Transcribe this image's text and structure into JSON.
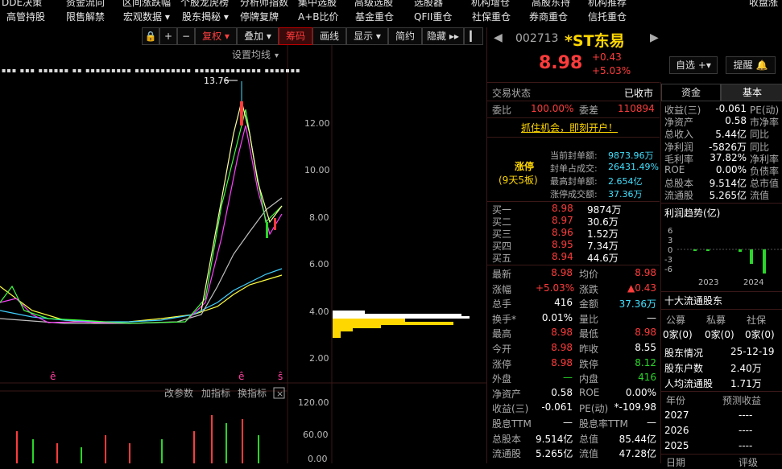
{
  "menu": {
    "row1": [
      "DDE决策",
      "资金流向",
      "区间涨跌幅",
      "个股龙虎榜",
      "分析师指数",
      "集中选股",
      "高级选股",
      "选股器",
      "机构增仓",
      "高股东持",
      "机构推荐",
      "收盘涨"
    ],
    "row2": [
      "高管持股",
      "限售解禁",
      "宏观数据 ▾",
      "股东揭秘 ▾",
      "停牌复牌",
      "A+B比价",
      "基金重仓",
      "QFII重仓",
      "社保重仓",
      "券商重仓",
      "信托重仓"
    ]
  },
  "toolbar": {
    "fuquan": "复权",
    "overlay": "叠加",
    "chip": "筹码",
    "draw": "画线",
    "display": "显示",
    "simple": "简约",
    "hide": "隐藏"
  },
  "chart": {
    "ma_settings": "设置均线",
    "price_axis": [
      "12.00",
      "10.00",
      "8.00",
      "6.00",
      "4.00",
      "2.00"
    ],
    "peak_label": "13.76",
    "indicator_btns": [
      "改参数",
      "加指标",
      "换指标"
    ],
    "vol_axis": [
      "120.00",
      "60.00",
      "0.00"
    ]
  },
  "quote": {
    "code": "002713",
    "name": "*ST东易",
    "price": "8.98",
    "change": "+0.43",
    "pct": "+5.03%",
    "btn_watch": "自选",
    "btn_alert": "提醒",
    "trade_state_label": "交易状态",
    "trade_state": "已收市",
    "weibi_label": "委比",
    "weibi": "100.00%",
    "weicha_label": "委差",
    "weicha": "110894",
    "promo": "抓住机会，即刻开户！",
    "limit_tag": "涨停",
    "limit_days": "(9天5板)",
    "limit_rows": [
      [
        "当前封单额:",
        "9873.96万"
      ],
      [
        "封单占成交:",
        "26431.49%"
      ],
      [
        "最高封单额:",
        "2.654亿"
      ],
      [
        "涨停成交额:",
        "37.36万"
      ]
    ],
    "bids": [
      [
        "买一",
        "8.98",
        "9874万"
      ],
      [
        "买二",
        "8.97",
        "30.6万"
      ],
      [
        "买三",
        "8.96",
        "1.52万"
      ],
      [
        "买四",
        "8.95",
        "7.34万"
      ],
      [
        "买五",
        "8.94",
        "44.6万"
      ]
    ],
    "stats": [
      [
        "最新",
        "8.98",
        "均价",
        "8.98"
      ],
      [
        "涨幅",
        "+5.03%",
        "涨跌",
        "▲0.43"
      ],
      [
        "总手",
        "416",
        "金额",
        "37.36万"
      ],
      [
        "换手*",
        "0.01%",
        "量比",
        "—"
      ],
      [
        "最高",
        "8.98",
        "最低",
        "8.98"
      ],
      [
        "今开",
        "8.98",
        "昨收",
        "8.55"
      ],
      [
        "涨停",
        "8.98",
        "跌停",
        "8.12"
      ],
      [
        "外盘",
        "—",
        "内盘",
        "416"
      ],
      [
        "净资产",
        "0.58",
        "ROE",
        "0.00%"
      ],
      [
        "收益(三)",
        "-0.061",
        "PE(动)",
        "*-109.98"
      ],
      [
        "股息TTM",
        "—",
        "股息率TTM",
        "—"
      ],
      [
        "总股本",
        "9.514亿",
        "总值",
        "85.44亿"
      ],
      [
        "流通股",
        "5.265亿",
        "流值",
        "47.28亿"
      ]
    ]
  },
  "side": {
    "tabs": [
      "资金",
      "基本"
    ],
    "rows": [
      [
        "收益(三)",
        "-0.061",
        "PE(动)"
      ],
      [
        "净资产",
        "0.58",
        "市净率"
      ],
      [
        "总收入",
        "5.44亿",
        "同比"
      ],
      [
        "净利润",
        "-5826万",
        "同比"
      ],
      [
        "毛利率",
        "37.82%",
        "净利率"
      ],
      [
        "ROE",
        "0.00%",
        "负债率"
      ],
      [
        "总股本",
        "9.514亿",
        "总市值"
      ],
      [
        "流通股",
        "5.265亿",
        "流值"
      ]
    ],
    "profit_title": "利润趋势(亿)",
    "profit_axis": [
      "6",
      "3",
      "0",
      "-3",
      "-6"
    ],
    "profit_years": [
      "2023",
      "2024"
    ],
    "holders_title": "十大流通股东",
    "holder_heads": [
      "公募",
      "私募",
      "社保"
    ],
    "holder_vals": [
      "0家(0)",
      "0家(0)",
      "0家(0)"
    ],
    "holder_info": [
      [
        "股东情况",
        "25-12-19"
      ],
      [
        "股东户数",
        "2.40万"
      ],
      [
        "人均流通股",
        "1.71万"
      ]
    ],
    "eps_heads": [
      "年份",
      "预测收益"
    ],
    "eps_rows": [
      [
        "2027",
        "----"
      ],
      [
        "2026",
        "----"
      ],
      [
        "2025",
        "----"
      ]
    ],
    "bottom_heads": [
      "日期",
      "评级"
    ]
  },
  "colors": {
    "up": "#ff3b3b",
    "down": "#29d629",
    "accent": "#ffd700"
  }
}
